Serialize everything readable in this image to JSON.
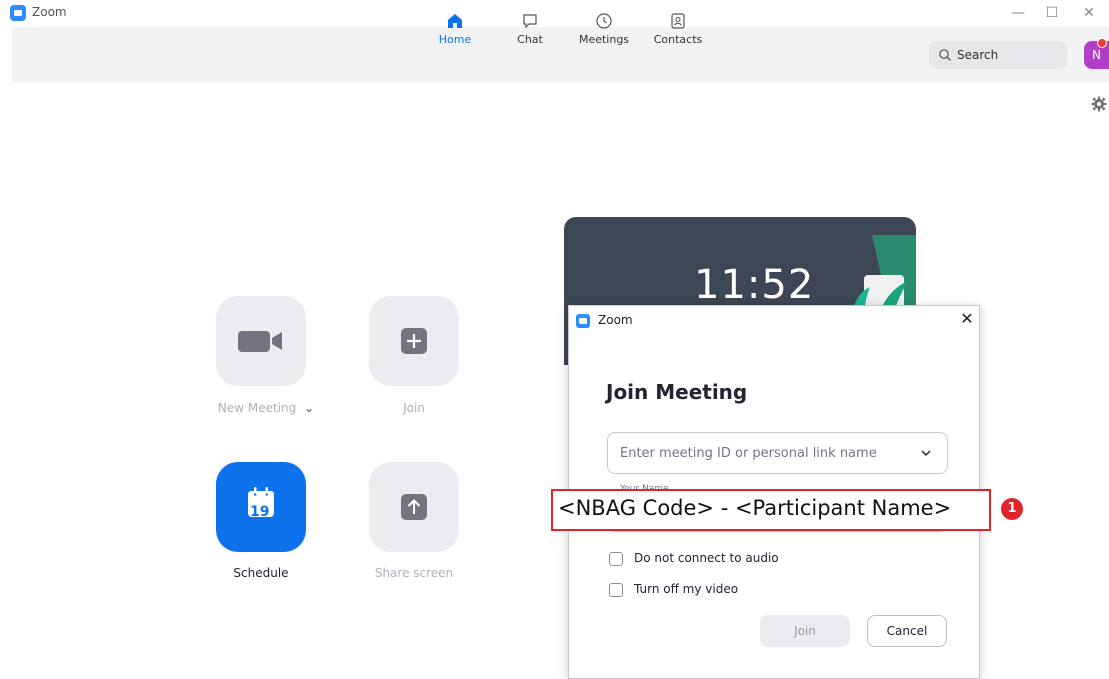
{
  "window": {
    "title": "Zoom",
    "minimize_glyph": "—",
    "maximize_glyph": "☐",
    "close_glyph": "✕"
  },
  "nav": {
    "tabs": [
      {
        "label": "Home",
        "icon": "home-icon",
        "active": true
      },
      {
        "label": "Chat",
        "icon": "chat-bubble-icon",
        "active": false
      },
      {
        "label": "Meetings",
        "icon": "clock-icon",
        "active": false
      },
      {
        "label": "Contacts",
        "icon": "contacts-icon",
        "active": false
      }
    ],
    "search_placeholder": "Search",
    "avatar_initial": "N"
  },
  "home": {
    "new_meeting_label": "New Meeting",
    "new_meeting_caret": "⌄",
    "join_label": "Join",
    "schedule_label": "Schedule",
    "schedule_day": "19",
    "share_screen_label": "Share screen"
  },
  "calendar_card": {
    "time": "11:52"
  },
  "dialog": {
    "window_title": "Zoom",
    "close_glyph": "✕",
    "heading": "Join Meeting",
    "meeting_id_placeholder": "Enter meeting ID or personal link name",
    "name_label": "Your Name",
    "audio_option": "Do not connect to audio",
    "video_option": "Turn off my video",
    "join_button": "Join",
    "cancel_button": "Cancel"
  },
  "annotation": {
    "text": "<NBAG Code> - <Participant Name>",
    "badge": "1"
  },
  "colors": {
    "accent": "#0e72ed",
    "annotation": "#e0242a",
    "nav_bg": "#f2f2f4",
    "card_bg": "#3d4654"
  }
}
